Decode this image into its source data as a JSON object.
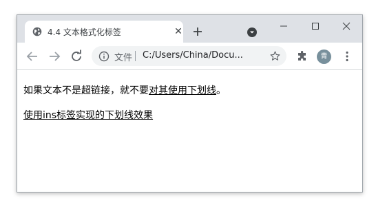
{
  "tab": {
    "title": "4.4 文本格式化标签",
    "close_glyph": "✕"
  },
  "window": {
    "buttons": [
      "minimize",
      "maximize",
      "close"
    ]
  },
  "address": {
    "chip_label": "文件",
    "url": "C:/Users/China/Docu..."
  },
  "profile": {
    "initial": "青"
  },
  "content": {
    "line1_plain": "如果文本不是超链接，就不要",
    "line1_underlined": "对其使用下划线",
    "line1_end": "。",
    "line2_underlined": "使用ins标签实现的下划线效果"
  },
  "colors": {
    "titlebar": "#dee1e6",
    "tab": "#ffffff",
    "omnibox": "#f1f3f4",
    "avatar": "#78909c"
  },
  "icons": [
    "globe-icon",
    "close-icon",
    "plus-icon",
    "tab-search-icon",
    "minimize-icon",
    "maximize-icon",
    "window-close-icon",
    "back-icon",
    "forward-icon",
    "reload-icon",
    "info-icon",
    "star-icon",
    "extensions-icon",
    "menu-icon"
  ]
}
